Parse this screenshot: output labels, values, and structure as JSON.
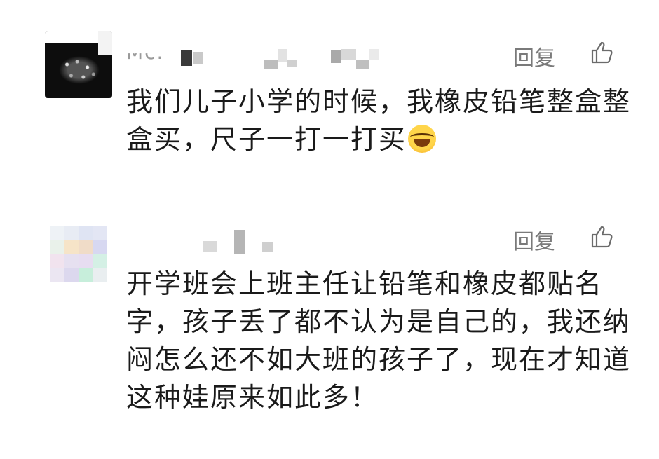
{
  "comments": [
    {
      "name_visible": "Mc.",
      "reply_label": "回复",
      "text": "我们儿子小学的时候，我橡皮铅笔整盒整盒买，尺子一打一打买"
    },
    {
      "reply_label": "回复",
      "text": "开学班会上班主任让铅笔和橡皮都贴名字，孩子丢了都不认为是自己的，我还纳闷怎么还不如大班的孩子了，现在才知道这种娃原来如此多！"
    }
  ],
  "emoji_name": "laughing-crying-emoji",
  "icons": {
    "like": "thumbs-up-icon"
  },
  "colors": {
    "text": "#1a1a1a",
    "reply": "#7a7a7a",
    "background": "#ffffff"
  }
}
